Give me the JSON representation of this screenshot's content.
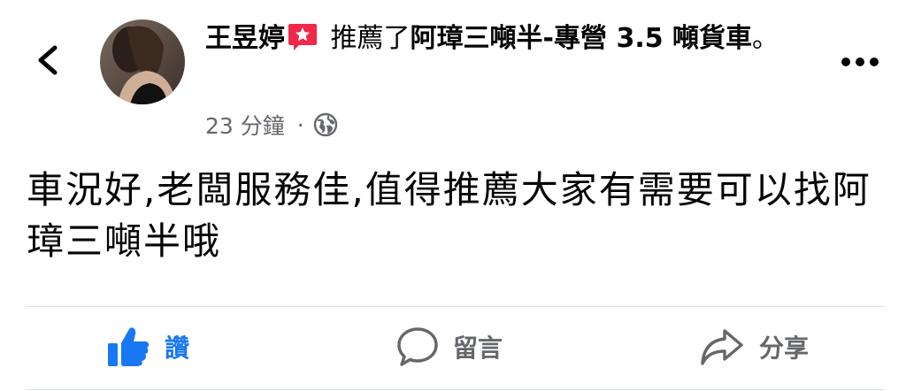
{
  "header": {
    "author": "王昱婷",
    "action_text": " 推薦了",
    "page_name": "阿璋三噸半-專營 3.5 噸貨車",
    "period": "。",
    "timestamp": "23 分鐘",
    "separator": "·",
    "privacy_icon": "globe-icon",
    "badge_icon": "star-badge-icon",
    "back_icon": "chevron-left-icon",
    "more_icon": "more-dots-icon"
  },
  "post": {
    "text": "車況好,老闆服務佳,值得推薦大家有需要可以找阿璋三噸半哦"
  },
  "actions": {
    "like_label": "讚",
    "comment_label": "留言",
    "share_label": "分享"
  },
  "colors": {
    "like_blue": "#1877f2",
    "badge_pink": "#f02849",
    "secondary_text": "#65676b",
    "divider": "#dadde1"
  }
}
